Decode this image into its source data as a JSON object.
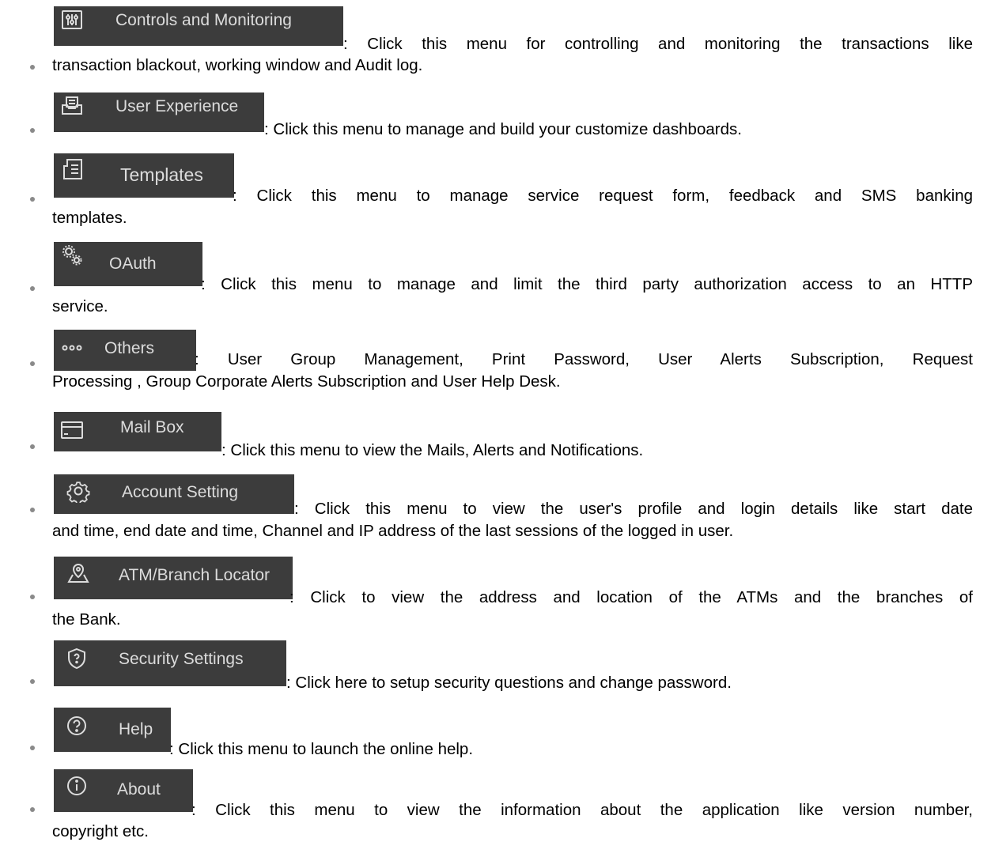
{
  "items": [
    {
      "icon": "sliders-icon",
      "button_label": "Controls and Monitoring",
      "line1": ": Click this menu for controlling and monitoring the transactions like",
      "line2": "transaction blackout, working window and Audit log."
    },
    {
      "icon": "inbox-icon",
      "button_label": "User Experience",
      "line1": ":  Click this menu to manage and build your customize dashboards."
    },
    {
      "icon": "document-icon",
      "button_label": "Templates",
      "line1": ": Click this menu to manage service request form, feedback and SMS banking",
      "line2": "templates."
    },
    {
      "icon": "gears-icon",
      "button_label": "OAuth",
      "line1": ": Click this menu to manage and limit the third party authorization access to an HTTP",
      "line2": "service."
    },
    {
      "icon": "more-dots-icon",
      "button_label": "Others",
      "line1": ": User Group Management, Print Password, User Alerts Subscription, Request",
      "line2": "Processing , Group Corporate Alerts Subscription and User Help Desk."
    },
    {
      "icon": "mail-card-icon",
      "button_label": "Mail Box",
      "line1": ": Click this menu to view the Mails, Alerts and Notifications."
    },
    {
      "icon": "gear-icon",
      "button_label": "Account Setting",
      "line1": ": Click this menu to view the user's profile and   login details like start date",
      "line2": "and time, end date and time, Channel and IP address of the last sessions of the  logged in user."
    },
    {
      "icon": "map-pin-icon",
      "button_label": "ATM/Branch Locator",
      "line1": ": Click to view the address and location of the ATMs and the branches of",
      "line2": "the Bank."
    },
    {
      "icon": "shield-question-icon",
      "button_label": "Security Settings",
      "line1": ": Click here to setup security questions and change password."
    },
    {
      "icon": "help-circle-icon",
      "button_label": "Help",
      "line1": ": Click this menu to launch the online help."
    },
    {
      "icon": "info-circle-icon",
      "button_label": "About",
      "line1": ": Click this menu to view the information about the application like version number,",
      "line2": "copyright etc."
    }
  ]
}
